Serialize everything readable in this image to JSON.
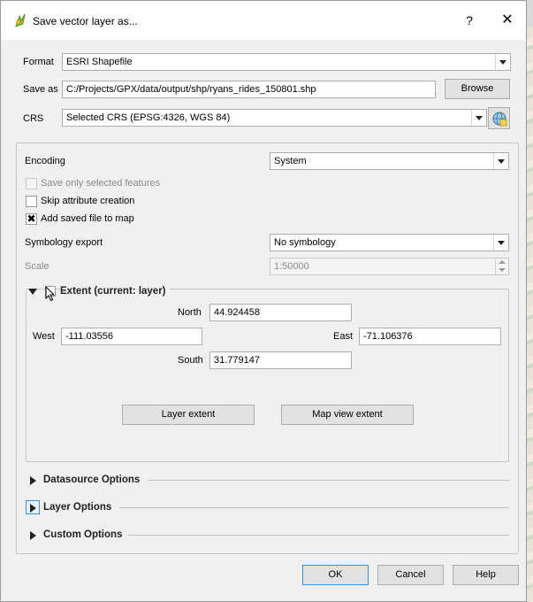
{
  "window": {
    "title": "Save vector layer as...",
    "help_glyph": "?",
    "close_glyph": "✕"
  },
  "format": {
    "label": "Format",
    "value": "ESRI Shapefile"
  },
  "save_as": {
    "label": "Save as",
    "value": "C:/Projects/GPX/data/output/shp/ryans_rides_150801.shp",
    "browse_label": "Browse"
  },
  "crs": {
    "label": "CRS",
    "value": "Selected CRS (EPSG:4326, WGS 84)",
    "icon": "globe-crs-icon"
  },
  "encoding": {
    "label": "Encoding",
    "value": "System"
  },
  "options": {
    "save_selected": {
      "label": "Save only selected features",
      "checked": false,
      "disabled": true
    },
    "skip_attr": {
      "label": "Skip attribute creation",
      "checked": false
    },
    "add_to_map": {
      "label": "Add saved file to map",
      "checked": true,
      "mark": "✖"
    }
  },
  "symbology": {
    "label": "Symbology export",
    "value": "No symbology"
  },
  "scale": {
    "label": "Scale",
    "value": "1:50000"
  },
  "extent": {
    "title": "Extent (current: layer)",
    "north_label": "North",
    "north": "44.924458",
    "west_label": "West",
    "west": "-111.03556",
    "east_label": "East",
    "east": "-71.106376",
    "south_label": "South",
    "south": "31.779147",
    "layer_extent_label": "Layer extent",
    "map_view_extent_label": "Map view extent"
  },
  "sections": {
    "datasource": "Datasource Options",
    "layer": "Layer Options",
    "custom": "Custom Options"
  },
  "buttons": {
    "ok": "OK",
    "cancel": "Cancel",
    "help": "Help"
  }
}
